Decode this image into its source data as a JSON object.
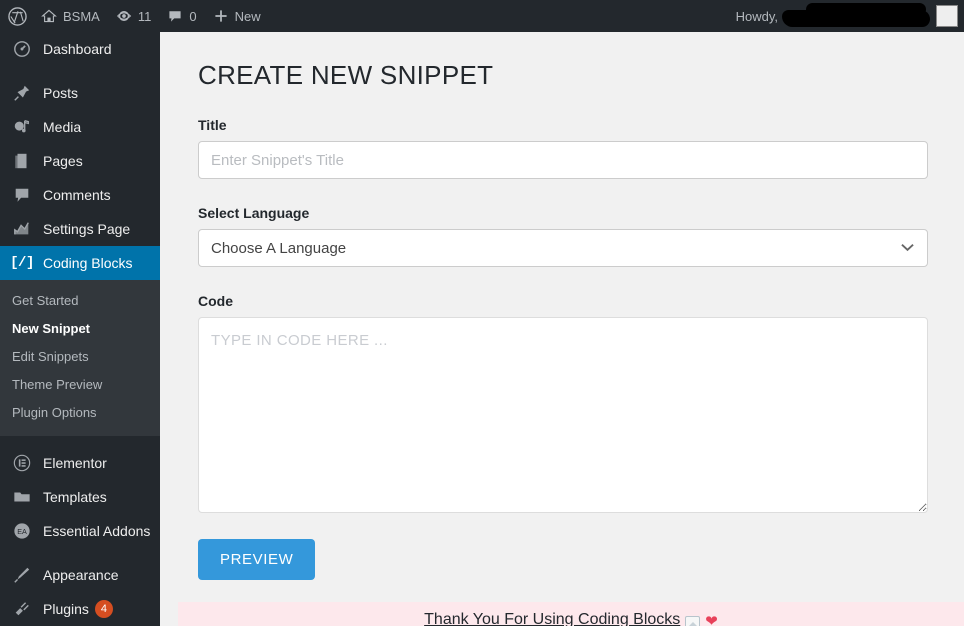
{
  "adminbar": {
    "logo_icon": "wordpress-logo-icon",
    "site_name": "BSMA",
    "home_icon": "home-icon",
    "updates_icon": "updates-icon",
    "updates_count": "11",
    "comments_icon": "comment-bubble-icon",
    "comments_count": "0",
    "new_icon": "plus-icon",
    "new_label": "New",
    "howdy_label": "Howdy,",
    "username": "",
    "avatar_icon": "avatar-placeholder-icon"
  },
  "sidebar": {
    "items": [
      {
        "label": "Dashboard",
        "icon": "dashboard-icon",
        "current": false,
        "spaced": false
      },
      {
        "label": "Posts",
        "icon": "pin-icon",
        "current": false,
        "spaced": true
      },
      {
        "label": "Media",
        "icon": "media-icon",
        "current": false,
        "spaced": false
      },
      {
        "label": "Pages",
        "icon": "pages-icon",
        "current": false,
        "spaced": false
      },
      {
        "label": "Comments",
        "icon": "comment-bubble-icon",
        "current": false,
        "spaced": false
      },
      {
        "label": "Settings Page",
        "icon": "chart-icon",
        "current": false,
        "spaced": false
      },
      {
        "label": "Coding Blocks",
        "icon": "code-brackets-icon",
        "current": true,
        "spaced": false
      }
    ],
    "submenu": [
      {
        "label": "Get Started",
        "current": false
      },
      {
        "label": "New Snippet",
        "current": true
      },
      {
        "label": "Edit Snippets",
        "current": false
      },
      {
        "label": "Theme Preview",
        "current": false
      },
      {
        "label": "Plugin Options",
        "current": false
      }
    ],
    "items_lower": [
      {
        "label": "Elementor",
        "icon": "elementor-icon",
        "spaced": true,
        "badge": ""
      },
      {
        "label": "Templates",
        "icon": "folder-icon",
        "spaced": false,
        "badge": ""
      },
      {
        "label": "Essential Addons",
        "icon": "essential-addons-icon",
        "spaced": false,
        "badge": ""
      },
      {
        "label": "Appearance",
        "icon": "brush-icon",
        "spaced": true,
        "badge": ""
      },
      {
        "label": "Plugins",
        "icon": "plug-icon",
        "spaced": false,
        "badge": "4"
      }
    ],
    "accent_color": "#0073aa",
    "background_color": "#23282d",
    "submenu_background": "#32373c"
  },
  "main": {
    "page_title": "CREATE NEW SNIPPET",
    "title_label": "Title",
    "title_placeholder": "Enter Snippet's Title",
    "title_value": "",
    "language_label": "Select Language",
    "language_selected": "Choose A Language",
    "language_chevron_icon": "chevron-down-icon",
    "code_label": "Code",
    "code_placeholder": "TYPE IN CODE HERE ...",
    "code_value": "",
    "preview_button": "PREVIEW",
    "preview_button_color": "#3498db"
  },
  "footer": {
    "text": "Thank You For Using Coding Blocks",
    "broken_image_icon": "broken-image-icon",
    "heart_icon": "heart-icon",
    "heart_glyph": "❤",
    "background_color": "#fde8ec"
  }
}
